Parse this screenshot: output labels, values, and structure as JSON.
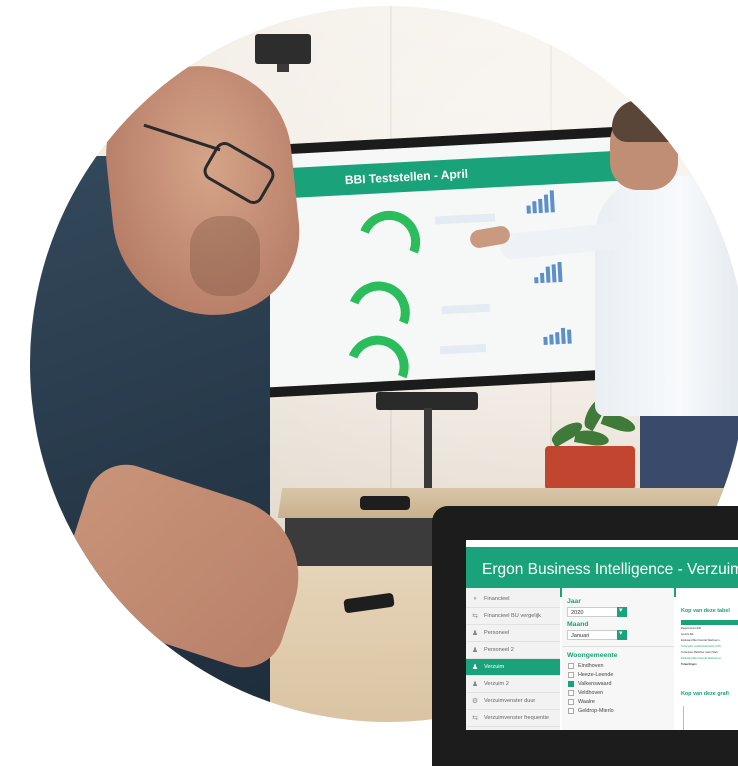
{
  "photo": {
    "description_tag": "office-meeting-with-dashboard"
  },
  "tv_dashboard": {
    "title": "BBI Teststellen - April"
  },
  "laptop_app": {
    "title": "Ergon Business Intelligence - Verzuim",
    "accent_color": "#1aa37a",
    "nav_items": [
      {
        "label": "Financieel",
        "icon": "coins-icon",
        "active": false
      },
      {
        "label": "Financieel BU vergelijk",
        "icon": "compare-icon",
        "active": false
      },
      {
        "label": "Personeel",
        "icon": "person-icon",
        "active": false
      },
      {
        "label": "Personeel 2",
        "icon": "person-icon",
        "active": false
      },
      {
        "label": "Verzuim",
        "icon": "person-group-icon",
        "active": true
      },
      {
        "label": "Verzuim 2",
        "icon": "person-group-icon",
        "active": false
      },
      {
        "label": "Verzuimvenster duur",
        "icon": "gear-person-icon",
        "active": false
      },
      {
        "label": "Verzuimvenster frequentie",
        "icon": "compare-icon",
        "active": false
      }
    ],
    "filters": {
      "jaar_label": "Jaar",
      "jaar_value": "2020",
      "maand_label": "Maand",
      "maand_value": "Januari",
      "woongemeente_label": "Woongemeente",
      "woongemeente_options": [
        {
          "label": "Eindhoven",
          "checked": false
        },
        {
          "label": "Heeze-Leende",
          "checked": false
        },
        {
          "label": "Valkenswaard",
          "checked": true
        },
        {
          "label": "Veldhoven",
          "checked": false
        },
        {
          "label": "Waalre",
          "checked": false
        },
        {
          "label": "Geldrop-Mierlo",
          "checked": false
        }
      ]
    },
    "main": {
      "table_title": "Kop van deze tabel",
      "table_rows": [
        {
          "text": "Regiomanent Eift",
          "style": "normal"
        },
        {
          "text": "Amarte BA",
          "style": "normal"
        },
        {
          "text": "Eindwand Met Suxnde Werkverm...",
          "style": "normal"
        },
        {
          "text": "Tozamplex Leidsenbsterschk (UIT)",
          "style": "highlight"
        },
        {
          "text": "Tozamplex Belerbuir work (Sfel)",
          "style": "normal"
        },
        {
          "text": "Eindwand Met Suxnde Werkvermo",
          "style": "highlight"
        },
        {
          "text": "Totaal Ergon",
          "style": "bold"
        }
      ],
      "graph_title": "Kop van deze grafi"
    }
  }
}
